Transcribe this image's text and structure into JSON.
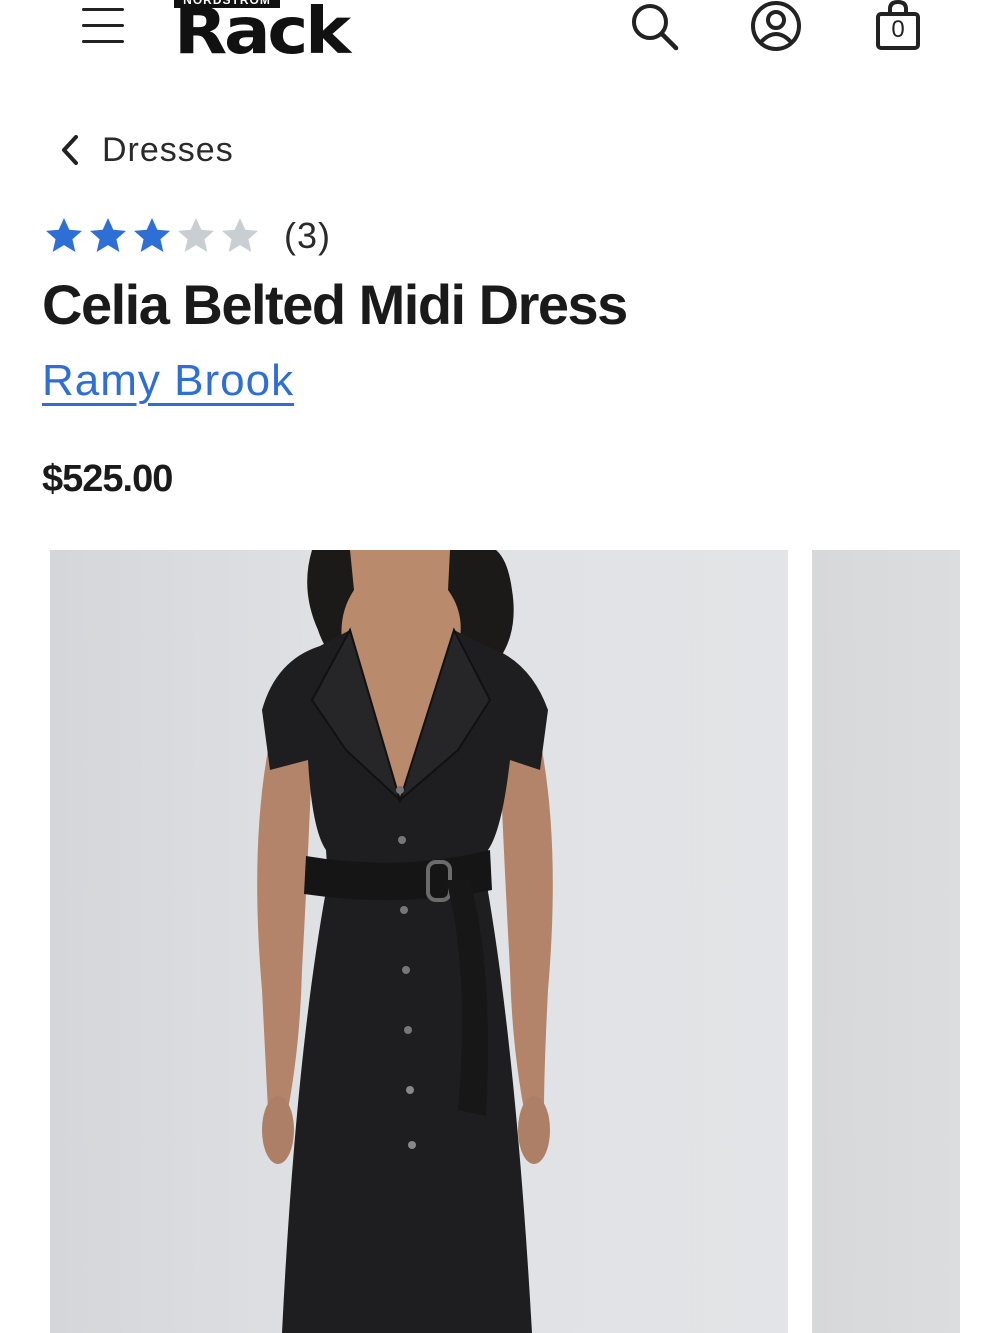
{
  "header": {
    "menu_icon": "hamburger-menu-icon",
    "logo": {
      "top": "NORDSTROM",
      "word": "Rack"
    },
    "icons": [
      "search-icon",
      "account-icon",
      "shopping-bag-icon"
    ],
    "bag_count": "0"
  },
  "breadcrumb": {
    "label": "Dresses",
    "icon": "chevron-left-icon"
  },
  "product": {
    "rating": 3,
    "rating_max": 5,
    "review_count": "(3)",
    "title": "Celia Belted Midi Dress",
    "brand": "Ramy Brook",
    "price": "$525.00"
  },
  "colors": {
    "star_filled": "#2e6fd6",
    "star_empty": "#c9ced3",
    "brand_link": "#2e6fd6",
    "image_bg": "#dfe1e4"
  }
}
